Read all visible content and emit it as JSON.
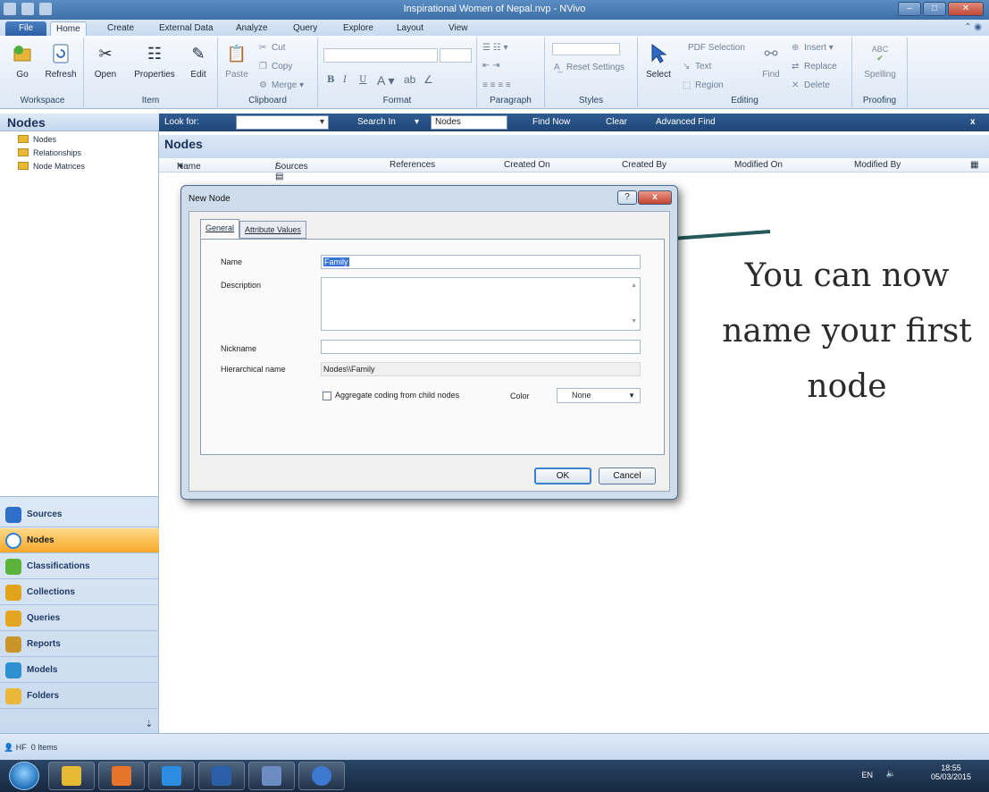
{
  "window": {
    "title": "Inspirational Women of Nepal.nvp - NVivo",
    "controls": [
      "–",
      "□",
      "✕"
    ]
  },
  "menu": {
    "tabs": [
      "File",
      "Home",
      "Create",
      "External Data",
      "Analyze",
      "Query",
      "Explore",
      "Layout",
      "View"
    ],
    "active": "Home"
  },
  "ribbon": {
    "workspace": {
      "label": "Workspace",
      "go": "Go",
      "refresh": "Refresh"
    },
    "item": {
      "label": "Item",
      "open": "Open",
      "properties": "Properties",
      "edit": "Edit"
    },
    "clipboard": {
      "label": "Clipboard",
      "paste": "Paste",
      "cut": "Cut",
      "copy": "Copy",
      "merge": "Merge"
    },
    "format": {
      "label": "Format",
      "bold": "B",
      "italic": "I",
      "underline": "U"
    },
    "paragraph": {
      "label": "Paragraph"
    },
    "styles": {
      "label": "Styles",
      "reset": "Reset Settings"
    },
    "editing": {
      "label": "Editing",
      "select": "Select",
      "pdf_selection": "PDF Selection",
      "text": "Text",
      "region": "Region",
      "find": "Find",
      "insert": "Insert",
      "replace": "Replace",
      "delete": "Delete"
    },
    "proofing": {
      "label": "Proofing",
      "spelling": "Spelling",
      "abc": "ABC"
    }
  },
  "lookbar": {
    "look_for": "Look for:",
    "search_in": "Search In",
    "search_in_value": "Nodes",
    "find_now": "Find Now",
    "clear": "Clear",
    "advanced_find": "Advanced Find",
    "close": "x"
  },
  "nav": {
    "title": "Nodes",
    "tree": [
      "Nodes",
      "Relationships",
      "Node Matrices"
    ],
    "groups": [
      "Sources",
      "Nodes",
      "Classifications",
      "Collections",
      "Queries",
      "Reports",
      "Models",
      "Folders"
    ],
    "active_group": "Nodes",
    "group_colors": [
      "#2f6fc9",
      "#3b8ee8",
      "#5bb33b",
      "#e2a21b",
      "#e6a520",
      "#c9952a",
      "#2e8fd1",
      "#e9b739"
    ]
  },
  "main": {
    "title": "Nodes",
    "columns": [
      "Name",
      "Sources",
      "References",
      "Created On",
      "Created By",
      "Modified On",
      "Modified By"
    ]
  },
  "dialog": {
    "title": "New Node",
    "help": "?",
    "close": "x",
    "tabs": [
      "General",
      "Attribute Values"
    ],
    "name_label": "Name",
    "name_value": "Family",
    "description_label": "Description",
    "nickname_label": "Nickname",
    "hierarchical_label": "Hierarchical name",
    "hierarchical_value": "Nodes\\\\Family",
    "aggregate_label": "Aggregate coding from child nodes",
    "color_label": "Color",
    "color_value": "None",
    "ok": "OK",
    "cancel": "Cancel"
  },
  "annotation": {
    "line1": "You can now",
    "line2": "name your first",
    "line3": "node"
  },
  "status": {
    "user": "HF",
    "items": "0 Items"
  },
  "taskbar": {
    "time": "18:55",
    "date": "05/03/2015",
    "lang": "EN",
    "app_colors": [
      "#e7b935",
      "#e8742a",
      "#2b8ee0",
      "#2c5fa8",
      "#6d8cc1",
      "#3b7ad0"
    ]
  },
  "colors": {
    "accent": "#2f5c92",
    "arrow": "#24585a",
    "selection": "#3875d7",
    "active_nav": "#f7a928"
  }
}
